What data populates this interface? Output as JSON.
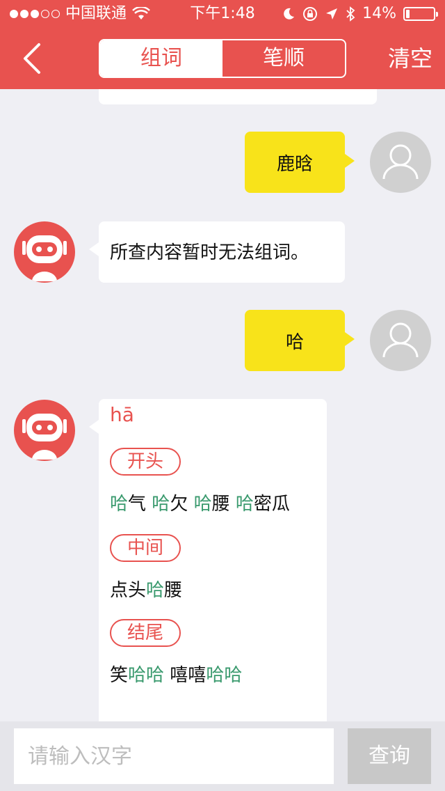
{
  "status": {
    "carrier": "中国联通",
    "time": "下午1:48",
    "battery": "14%",
    "battery_level": 0.14
  },
  "nav": {
    "tabs": [
      {
        "label": "组词",
        "active": true
      },
      {
        "label": "笔顺",
        "active": false
      }
    ],
    "clear_label": "清空"
  },
  "chat": {
    "messages": [
      {
        "sender": "user",
        "text": "鹿晗"
      },
      {
        "sender": "bot",
        "text": "所查内容暂时无法组词。"
      },
      {
        "sender": "user",
        "text": "哈"
      }
    ],
    "result": {
      "pinyin": "hā",
      "sections": [
        {
          "tag": "开头",
          "words": [
            [
              {
                "t": "哈",
                "h": true
              },
              {
                "t": "气",
                "h": false
              }
            ],
            [
              {
                "t": "哈",
                "h": true
              },
              {
                "t": "欠",
                "h": false
              }
            ],
            [
              {
                "t": "哈",
                "h": true
              },
              {
                "t": "腰",
                "h": false
              }
            ],
            [
              {
                "t": "哈",
                "h": true
              },
              {
                "t": "密瓜",
                "h": false
              }
            ]
          ]
        },
        {
          "tag": "中间",
          "words": [
            [
              {
                "t": "点头",
                "h": false
              },
              {
                "t": "哈",
                "h": true
              },
              {
                "t": "腰",
                "h": false
              }
            ]
          ]
        },
        {
          "tag": "结尾",
          "words": [
            [
              {
                "t": "笑",
                "h": false
              },
              {
                "t": "哈哈",
                "h": true
              }
            ],
            [
              {
                "t": "嘻嘻",
                "h": false
              },
              {
                "t": "哈哈",
                "h": true
              }
            ]
          ]
        }
      ]
    }
  },
  "input": {
    "placeholder": "请输入汉字",
    "value": "",
    "submit_label": "查询"
  },
  "colors": {
    "brand": "#e8524f",
    "user_bubble": "#f8e31a",
    "highlight": "#3a9a6e"
  }
}
